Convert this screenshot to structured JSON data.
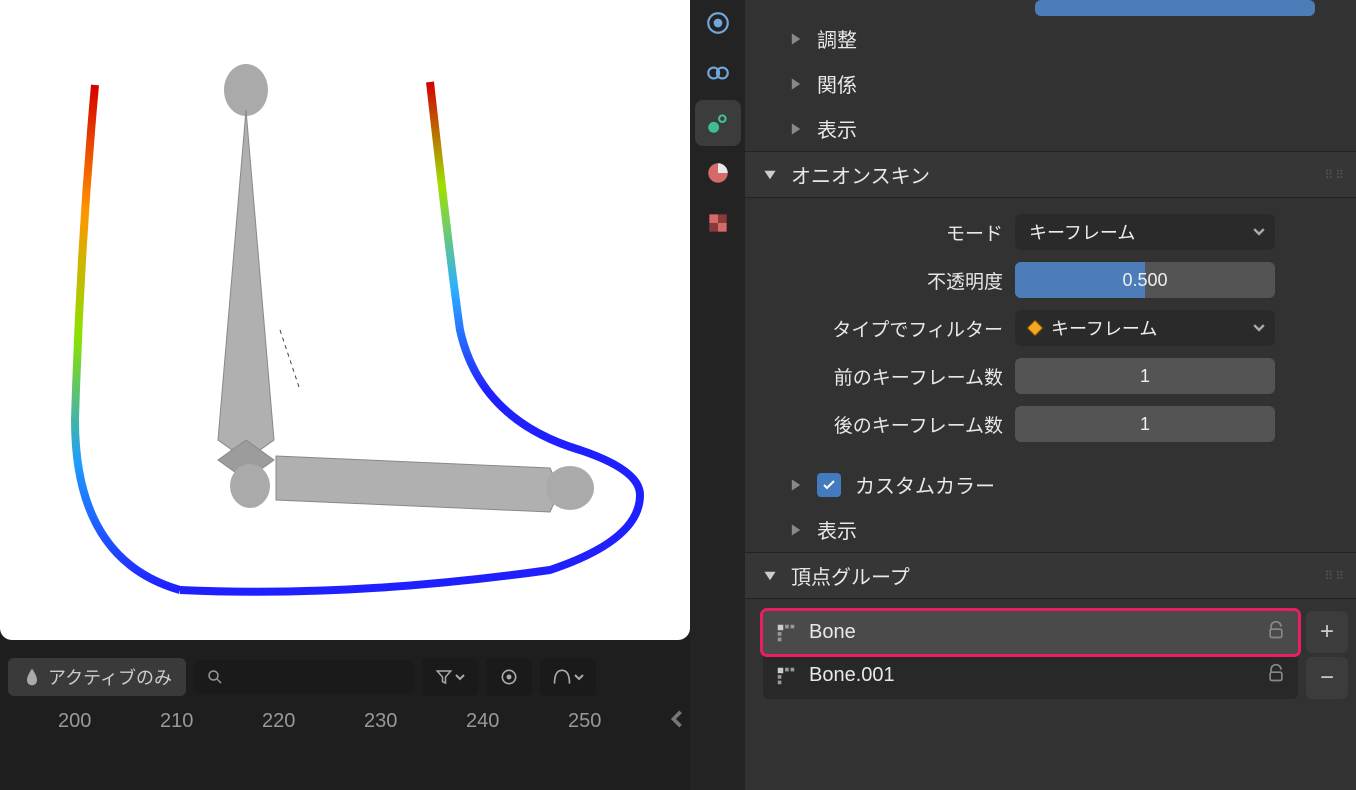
{
  "timeline": {
    "active_only_label": "アクティブのみ",
    "ruler": [
      "200",
      "210",
      "220",
      "230",
      "240",
      "250"
    ]
  },
  "panels": {
    "adjust": "調整",
    "relation": "関係",
    "display": "表示",
    "onion_header": "オニオンスキン",
    "mode_label": "モード",
    "mode_value": "キーフレーム",
    "opacity_label": "不透明度",
    "opacity_value": "0.500",
    "filter_label": "タイプでフィルター",
    "filter_value": "キーフレーム",
    "prev_kf_label": "前のキーフレーム数",
    "prev_kf_value": "1",
    "next_kf_label": "後のキーフレーム数",
    "next_kf_value": "1",
    "custom_color": "カスタムカラー",
    "display2": "表示",
    "vg_header": "頂点グループ"
  },
  "vertex_groups": [
    {
      "name": "Bone",
      "selected": true
    },
    {
      "name": "Bone.001",
      "selected": false
    }
  ]
}
